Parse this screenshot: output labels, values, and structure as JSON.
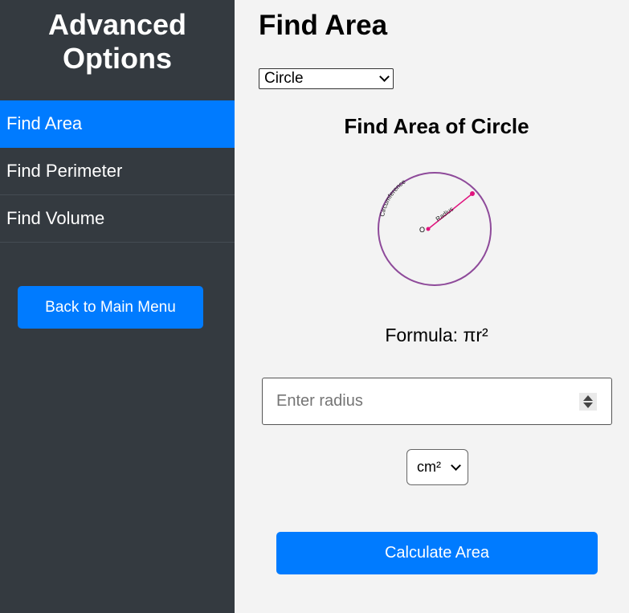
{
  "sidebar": {
    "title": "Advanced Options",
    "items": [
      {
        "label": "Find Area",
        "active": true
      },
      {
        "label": "Find Perimeter",
        "active": false
      },
      {
        "label": "Find Volume",
        "active": false
      }
    ],
    "back_button": "Back to Main Menu"
  },
  "main": {
    "title": "Find Area",
    "shape_select": {
      "value": "Circle"
    },
    "section_title": "Find Area of Circle",
    "diagram": {
      "circumference_label": "Circumference",
      "radius_label": "Radius",
      "center_label": "O"
    },
    "formula": "Formula: πr²",
    "radius_input": {
      "placeholder": "Enter radius",
      "value": ""
    },
    "unit_select": {
      "value": "cm²"
    },
    "calculate_button": "Calculate Area"
  },
  "colors": {
    "sidebar_bg": "#343a40",
    "accent": "#007bff",
    "circle_stroke": "#8e4a9a",
    "radius_color": "#e0127d"
  }
}
